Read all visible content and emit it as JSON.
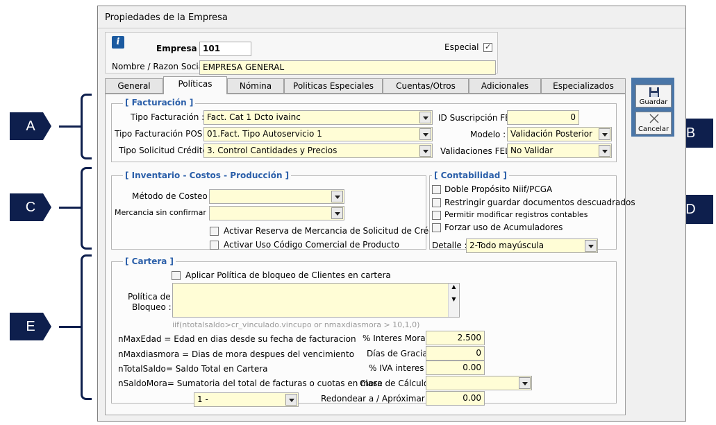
{
  "window": {
    "title": "Propiedades de la Empresa"
  },
  "header": {
    "empresa_label": "Empresa",
    "empresa_value": "101",
    "especial_label": "Especial",
    "especial_checked": true,
    "nombre_label": "Nombre / Razon Social",
    "nombre_value": "EMPRESA GENERAL"
  },
  "tabs": [
    {
      "label": "General",
      "active": false
    },
    {
      "label": "Políticas",
      "active": true
    },
    {
      "label": "Nómina",
      "active": false
    },
    {
      "label": "Politicas Especiales",
      "active": false
    },
    {
      "label": "Cuentas/Otros",
      "active": false
    },
    {
      "label": "Adicionales",
      "active": false
    },
    {
      "label": "Especializados",
      "active": false
    }
  ],
  "facturacion": {
    "title": "[ Facturación ]",
    "tipo_facturacion_label": "Tipo Facturación :",
    "tipo_facturacion_value": "Fact. Cat 1 Dcto ivainc",
    "tipo_pos_label": "Tipo Facturación POS :",
    "tipo_pos_value": "01.Fact. Tipo Autoservicio 1",
    "tipo_credito_label": "Tipo Solicitud Crédito:",
    "tipo_credito_value": "3. Control Cantidades y Precios",
    "id_suscripcion_label": "ID Suscripción FE :",
    "id_suscripcion_value": "0",
    "modelo_label": "Modelo :",
    "modelo_value": "Validación Posterior",
    "validaciones_label": "Validaciones FEL :",
    "validaciones_value": "No Validar"
  },
  "inventario": {
    "title": "[ Inventario - Costos - Producción ]",
    "metodo_label": "Método de Costeo :",
    "metodo_value": "",
    "mercancia_label": "Mercancia sin confirmar :",
    "mercancia_value": "",
    "reserva_label": "Activar Reserva de Mercancia de Solicitud de Crédito",
    "codigo_label": "Activar Uso Código Comercial de Producto"
  },
  "contabilidad": {
    "title": "[ Contabilidad ]",
    "options": [
      "Doble Propósito Niif/PCGA",
      "Restringir guardar documentos descuadrados",
      "Permitir modificar registros contables",
      "Forzar uso de Acumuladores"
    ],
    "detalle_label": "Detalle :",
    "detalle_value": "2-Todo mayúscula"
  },
  "cartera": {
    "title": "[ Cartera ]",
    "aplicar_label": "Aplicar Política de bloqueo de Clientes en cartera",
    "politica_label_1": "Política de",
    "politica_label_2": "Bloqueo :",
    "politica_value": "",
    "hint": "iif(ntotalsaldo>cr_vinculado.vincupo or nmaxdiasmora > 10,1,0)",
    "legend": [
      "nMaxEdad = Edad en dias desde su fecha de facturacion",
      "nMaxdiasmora = Dias de mora despues del vencimiento",
      "nTotalSaldo= Saldo Total en Cartera",
      "nSaldoMora= Sumatoria del total de facturas o cuotas en mora"
    ],
    "interes_mora_label": "% Interes Mora :",
    "interes_mora_value": "2.500",
    "dias_gracia_label": "Días de Gracia :",
    "dias_gracia_value": "0",
    "iva_label": "% IVA interes :",
    "iva_value": "0.00",
    "clase_label": "Clase de Cálculo :",
    "clase_value": "",
    "redondear_label": "Redondear a / Apróximar a :",
    "redondear_value": "0.00",
    "combo_value": "1 -"
  },
  "buttons": {
    "guardar": "Guardar",
    "cancelar": "Cancelar"
  },
  "callouts": [
    "A",
    "B",
    "C",
    "D",
    "E"
  ],
  "colors": {
    "callout": "#0e1f4d",
    "group_title": "#2b5fa9",
    "field_bg": "#fffdd6",
    "side_panel": "#4a76a8"
  }
}
